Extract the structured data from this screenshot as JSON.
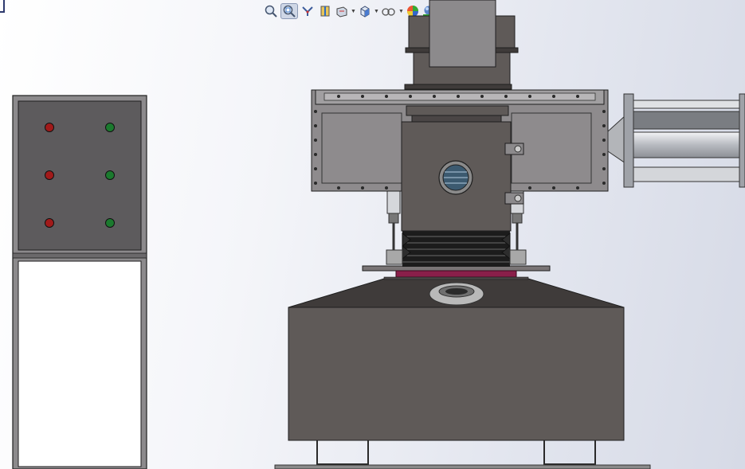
{
  "viewport": {
    "background_colors": [
      "#ffffff",
      "#e3e6ef",
      "#d6dae6"
    ]
  },
  "heads_up_toolbar": {
    "tools": [
      {
        "icon": "zoom-to-fit-icon",
        "active": false,
        "dropdown": false
      },
      {
        "icon": "zoom-to-area-icon",
        "active": true,
        "dropdown": false
      },
      {
        "icon": "previous-view-icon",
        "active": false,
        "dropdown": false
      },
      {
        "icon": "section-view-icon",
        "active": false,
        "dropdown": false
      },
      {
        "icon": "dynamic-annotation-views-icon",
        "active": false,
        "dropdown": true
      },
      {
        "icon": "view-orientation-icon",
        "active": false,
        "dropdown": true
      },
      {
        "icon": "display-style-icon",
        "active": false,
        "dropdown": true
      },
      {
        "icon": "hide-show-items-icon",
        "active": false,
        "dropdown": false
      },
      {
        "icon": "edit-appearance-icon",
        "active": false,
        "dropdown": true
      },
      {
        "icon": "apply-scene-icon",
        "active": false,
        "dropdown": true
      },
      {
        "icon": "view-settings-icon",
        "active": false,
        "dropdown": true
      }
    ]
  },
  "model": {
    "colors": {
      "body": "#5f5a58",
      "body_dark": "#3f3b3a",
      "panel": "#8c8a8c",
      "edge": "#1f1f1f",
      "frame": "#666666",
      "light_red": "#a11a1a",
      "light_green": "#1b7a2e",
      "gasket": "#8a1f4a",
      "cylinder": "#c9ccd2"
    },
    "control_cabinet": {
      "indicator_lights": [
        {
          "color": "red"
        },
        {
          "color": "green"
        },
        {
          "color": "red"
        },
        {
          "color": "green"
        },
        {
          "color": "red"
        },
        {
          "color": "green"
        }
      ]
    }
  }
}
